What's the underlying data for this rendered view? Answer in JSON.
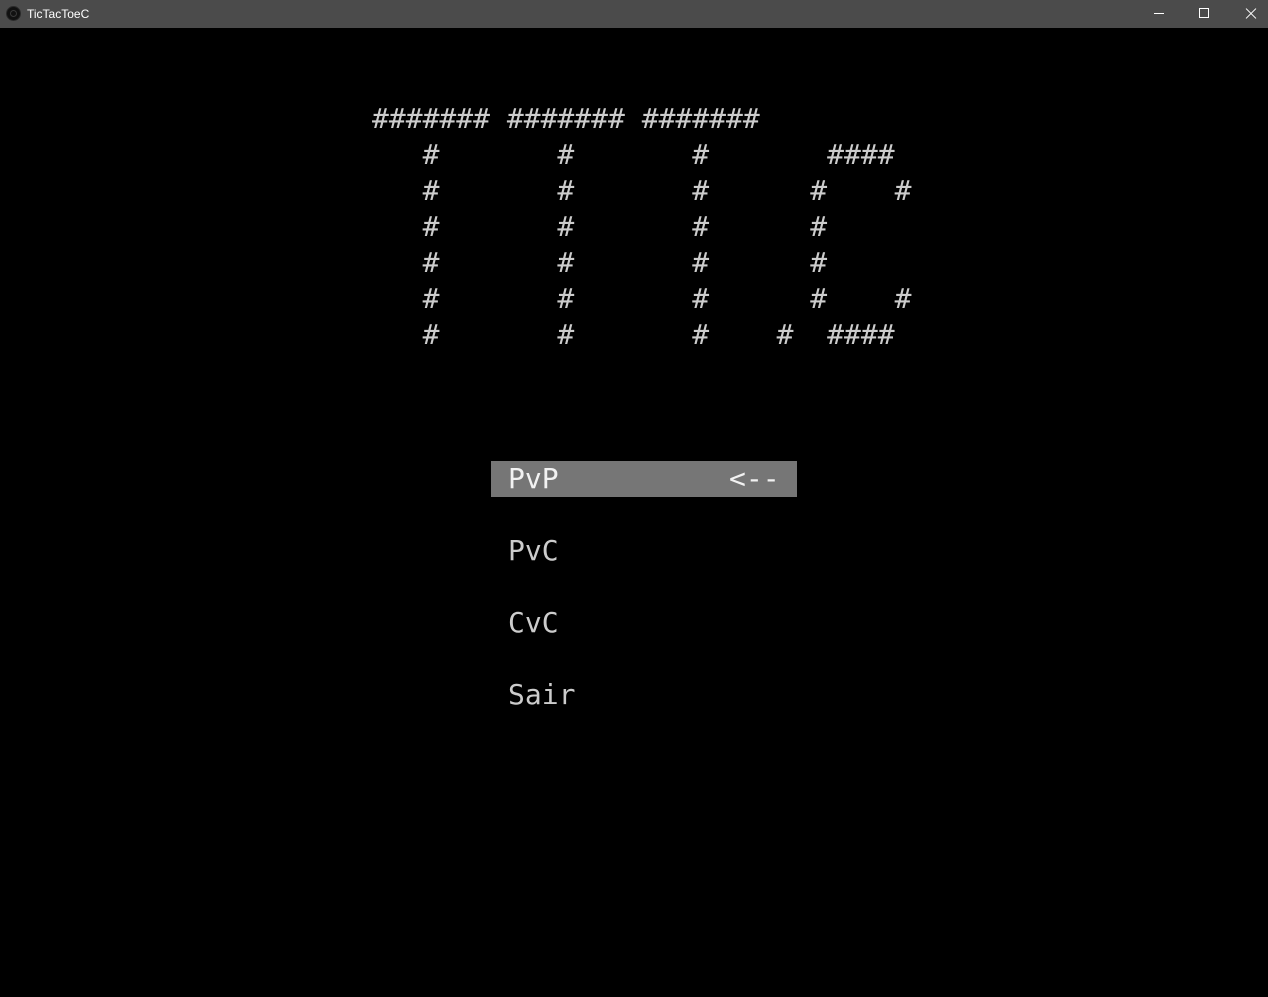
{
  "window": {
    "title": "TicTacToeC",
    "app_icon": "app-icon",
    "controls": {
      "minimize_icon": "minimize-icon",
      "maximize_icon": "maximize-icon",
      "close_icon": "close-icon"
    }
  },
  "console": {
    "background": "#000000",
    "text_color": "#cccccc",
    "banner": [
      "####### ####### #######",
      "   #       #       #       ####",
      "   #       #       #      #    #",
      "   #       #       #      #",
      "   #       #       #      #",
      "   #       #       #      #    #",
      "   #       #       #    #  ####"
    ],
    "menu": {
      "selected_background": "#767676",
      "items": [
        {
          "label": "PvP",
          "selected": true
        },
        {
          "label": "PvC",
          "selected": false
        },
        {
          "label": "CvC",
          "selected": false
        },
        {
          "label": "Sair",
          "selected": false
        }
      ],
      "pointer": "<--"
    }
  }
}
